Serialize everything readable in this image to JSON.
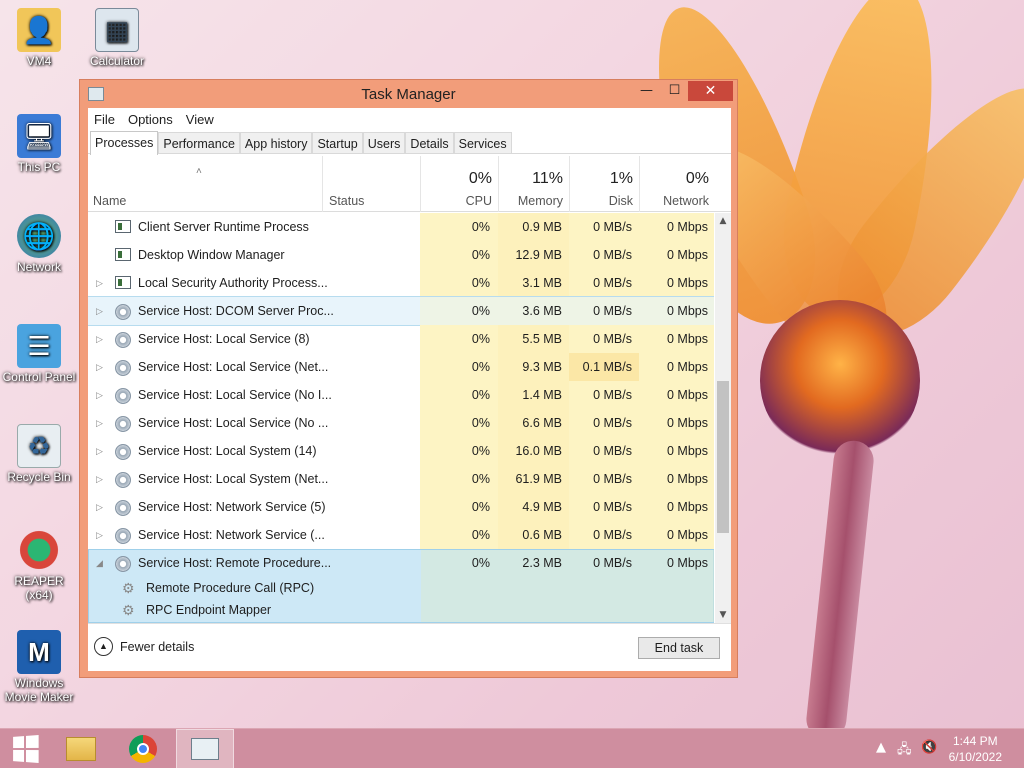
{
  "desktop": {
    "icons": [
      {
        "label": "VM4",
        "icon": "user-folder-icon"
      },
      {
        "label": "Calculator",
        "icon": "calculator-icon"
      },
      {
        "label": "This PC",
        "icon": "computer-icon"
      },
      {
        "label": "Network",
        "icon": "network-icon"
      },
      {
        "label": "Control Panel",
        "icon": "control-panel-icon"
      },
      {
        "label": "Recycle Bin",
        "icon": "recycle-bin-icon"
      },
      {
        "label": "REAPER (x64)",
        "icon": "reaper-icon"
      },
      {
        "label": "Windows\nMovie Maker",
        "icon": "movie-maker-icon"
      }
    ]
  },
  "window": {
    "title": "Task Manager",
    "controls": {
      "minimize": "—",
      "maximize": "☐",
      "close": "✕"
    },
    "accent": "#f29d7a"
  },
  "menu": [
    "File",
    "Options",
    "View"
  ],
  "tabs": [
    "Processes",
    "Performance",
    "App history",
    "Startup",
    "Users",
    "Details",
    "Services"
  ],
  "active_tab": "Processes",
  "columns": {
    "name": "Name",
    "status": "Status",
    "cpu": {
      "pct": "0%",
      "label": "CPU"
    },
    "memory": {
      "pct": "11%",
      "label": "Memory"
    },
    "disk": {
      "pct": "1%",
      "label": "Disk"
    },
    "network": {
      "pct": "0%",
      "label": "Network"
    }
  },
  "rows": [
    {
      "name": "Client Server Runtime Process",
      "expand": "",
      "icon": "window-icon",
      "cpu": "0%",
      "mem": "0.9 MB",
      "disk": "0 MB/s",
      "net": "0 Mbps"
    },
    {
      "name": "Desktop Window Manager",
      "expand": "",
      "icon": "window-icon",
      "cpu": "0%",
      "mem": "12.9 MB",
      "disk": "0 MB/s",
      "net": "0 Mbps"
    },
    {
      "name": "Local Security Authority Process...",
      "expand": "▷",
      "icon": "window-icon",
      "cpu": "0%",
      "mem": "3.1 MB",
      "disk": "0 MB/s",
      "net": "0 Mbps"
    },
    {
      "name": "Service Host: DCOM Server Proc...",
      "expand": "▷",
      "icon": "gear-icon",
      "cpu": "0%",
      "mem": "3.6 MB",
      "disk": "0 MB/s",
      "net": "0 Mbps"
    },
    {
      "name": "Service Host: Local Service (8)",
      "expand": "▷",
      "icon": "gear-icon",
      "cpu": "0%",
      "mem": "5.5 MB",
      "disk": "0 MB/s",
      "net": "0 Mbps"
    },
    {
      "name": "Service Host: Local Service (Net...",
      "expand": "▷",
      "icon": "gear-icon",
      "cpu": "0%",
      "mem": "9.3 MB",
      "disk": "0.1 MB/s",
      "net": "0 Mbps"
    },
    {
      "name": "Service Host: Local Service (No I...",
      "expand": "▷",
      "icon": "gear-icon",
      "cpu": "0%",
      "mem": "1.4 MB",
      "disk": "0 MB/s",
      "net": "0 Mbps"
    },
    {
      "name": "Service Host: Local Service (No ...",
      "expand": "▷",
      "icon": "gear-icon",
      "cpu": "0%",
      "mem": "6.6 MB",
      "disk": "0 MB/s",
      "net": "0 Mbps"
    },
    {
      "name": "Service Host: Local System (14)",
      "expand": "▷",
      "icon": "gear-icon",
      "cpu": "0%",
      "mem": "16.0 MB",
      "disk": "0 MB/s",
      "net": "0 Mbps"
    },
    {
      "name": "Service Host: Local System (Net...",
      "expand": "▷",
      "icon": "gear-icon",
      "cpu": "0%",
      "mem": "61.9 MB",
      "disk": "0 MB/s",
      "net": "0 Mbps"
    },
    {
      "name": "Service Host: Network Service (5)",
      "expand": "▷",
      "icon": "gear-icon",
      "cpu": "0%",
      "mem": "4.9 MB",
      "disk": "0 MB/s",
      "net": "0 Mbps"
    },
    {
      "name": "Service Host: Network Service (...",
      "expand": "▷",
      "icon": "gear-icon",
      "cpu": "0%",
      "mem": "0.6 MB",
      "disk": "0 MB/s",
      "net": "0 Mbps"
    },
    {
      "name": "Service Host: Remote Procedure...",
      "expand": "◢",
      "icon": "gear-icon",
      "cpu": "0%",
      "mem": "2.3 MB",
      "disk": "0 MB/s",
      "net": "0 Mbps"
    }
  ],
  "subrows": [
    "Remote Procedure Call (RPC)",
    "RPC Endpoint Mapper"
  ],
  "footer": {
    "fewer_details": "Fewer details",
    "end_task": "End task"
  },
  "taskbar": {
    "apps": [
      "file-explorer-icon",
      "chrome-icon",
      "task-manager-icon"
    ],
    "time": "1:44 PM",
    "date": "6/10/2022"
  }
}
